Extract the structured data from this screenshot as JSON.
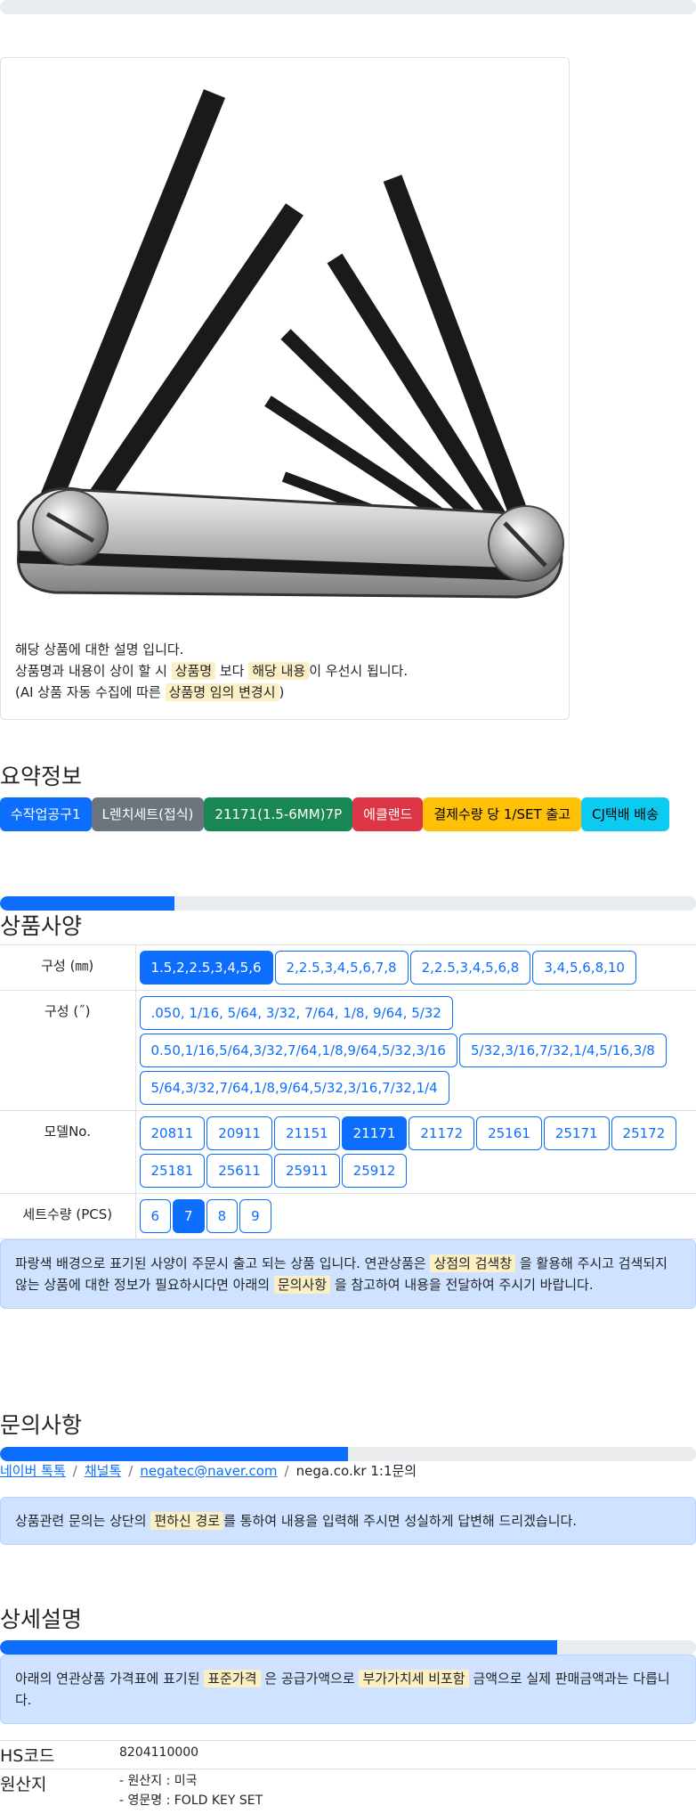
{
  "product": {
    "notes": {
      "line1": "해당 상품에 대한 설명 입니다.",
      "line2_a": "상품명과 내용이 상이 할 시",
      "line2_mark1": "상품명",
      "line2_b": "보다",
      "line2_mark2": "해당 내용",
      "line2_c": "이 우선시 됩니다.",
      "line3_a": "(AI 상품 자동 수집에 따른",
      "line3_mark": "상품명 임의 변경시",
      "line3_b": ")"
    }
  },
  "summary": {
    "title": "요약정보",
    "badges": [
      {
        "label": "수작업공구1",
        "bg": "#0d6efd",
        "fg": "#ffffff"
      },
      {
        "label": "L렌치세트(접식)",
        "bg": "#6c757d",
        "fg": "#ffffff"
      },
      {
        "label": "21171(1.5-6MM)7P",
        "bg": "#198754",
        "fg": "#ffffff"
      },
      {
        "label": "에클랜드",
        "bg": "#dc3545",
        "fg": "#ffffff"
      },
      {
        "label": "결제수량 당 1/SET 출고",
        "bg": "#ffc107",
        "fg": "#000000"
      },
      {
        "label": "CJ택배 배송",
        "bg": "#0dcaf0",
        "fg": "#000000"
      }
    ]
  },
  "specs": {
    "title": "상품사양",
    "progress": 0.25,
    "rows": [
      {
        "label": "구성 (㎜)",
        "options": [
          "1.5,2,2.5,3,4,5,6",
          "2,2.5,3,4,5,6,7,8",
          "2,2.5,3,4,5,6,8",
          "3,4,5,6,8,10"
        ],
        "selected": 0
      },
      {
        "label": "구성 (˝)",
        "options": [
          ".050, 1/16, 5/64, 3/32, 7/64, 1/8, 9/64, 5/32",
          "0.50,1/16,5/64,3/32,7/64,1/8,9/64,5/32,3/16",
          "5/32,3/16,7/32,1/4,5/16,3/8",
          "5/64,3/32,7/64,1/8,9/64,5/32,3/16,7/32,1/4"
        ],
        "selected": -1
      },
      {
        "label": "모델No.",
        "options": [
          "20811",
          "20911",
          "21151",
          "21171",
          "21172",
          "25161",
          "25171",
          "25172",
          "25181",
          "25611",
          "25911",
          "25912"
        ],
        "selected": 3
      },
      {
        "label": "세트수량 (PCS)",
        "options": [
          "6",
          "7",
          "8",
          "9"
        ],
        "selected": 1
      }
    ],
    "alert": {
      "a": "파랑색 배경으로 표기된 사양이 주문시 출고 되는 상품 입니다. 연관상품은",
      "mark1": "상점의 검색창",
      "b": "을 활용해 주시고 검색되지 않는 상품에 대한 정보가 필요하시다면 아래의",
      "mark2": "문의사항",
      "c": "을 참고하여 내용을 전달하여 주시기 바랍니다."
    }
  },
  "inquiry": {
    "title": "문의사항",
    "progress": 0.5,
    "links": [
      "네이버 톡톡",
      "채널톡",
      "negatec@naver.com"
    ],
    "plain": "nega.co.kr 1:1문의",
    "separator": "/",
    "alert": {
      "a": "상품관련 문의는 상단의",
      "mark": "편하신 경로",
      "b": "를 통하여 내용을 입력해 주시면 성실하게 답변해 드리겠습니다."
    }
  },
  "detail": {
    "title": "상세설명",
    "progress": 0.8,
    "alert": {
      "a": "아래의 연관상품 가격표에 표기된",
      "mark1": "표준가격",
      "b": "은 공급가액으로",
      "mark2": "부가가치세 비포함",
      "c": "금액으로 실제 판매금액과는 다릅니다."
    },
    "info": [
      {
        "key": "HS코드",
        "values": [
          "8204110000"
        ]
      },
      {
        "key": "원산지",
        "values": [
          "- 원산지 : 미국",
          "- 영문명 : FOLD KEY SET"
        ]
      }
    ]
  }
}
